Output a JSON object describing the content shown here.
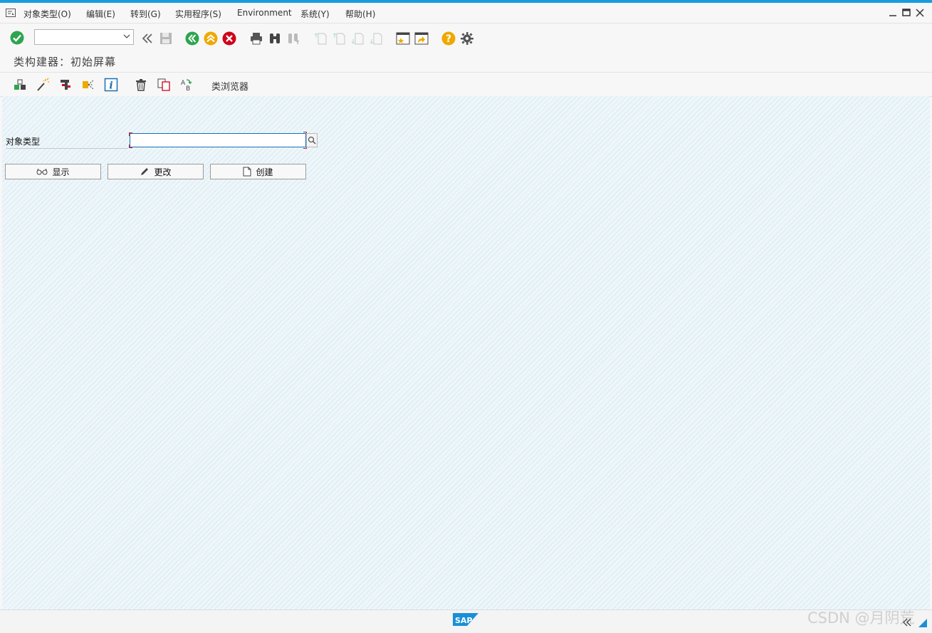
{
  "colors": {
    "accent": "#1a9be0",
    "ok_green": "#2ea44f",
    "cancel_red": "#d0021b",
    "help_yellow": "#f0a800",
    "nav_yellow": "#f0a800",
    "nav_green": "#2ea44f"
  },
  "menubar": {
    "items": [
      {
        "label": "对象类型(O)"
      },
      {
        "label": "编辑(E)"
      },
      {
        "label": "转到(G)"
      },
      {
        "label": "实用程序(S)"
      },
      {
        "label": "Environment"
      },
      {
        "label": "系统(Y)"
      },
      {
        "label": "帮助(H)"
      }
    ]
  },
  "command_field": {
    "value": ""
  },
  "screen": {
    "title": "类构建器：初始屏幕"
  },
  "app_toolbar": {
    "class_browser_label": "类浏览器"
  },
  "form": {
    "object_type_label": "对象类型",
    "object_type_value": ""
  },
  "buttons": {
    "display": "显示",
    "change": "更改",
    "create": "创建"
  },
  "status": {
    "logo_text": "SAP"
  },
  "watermark": "CSDN @月阴荒"
}
